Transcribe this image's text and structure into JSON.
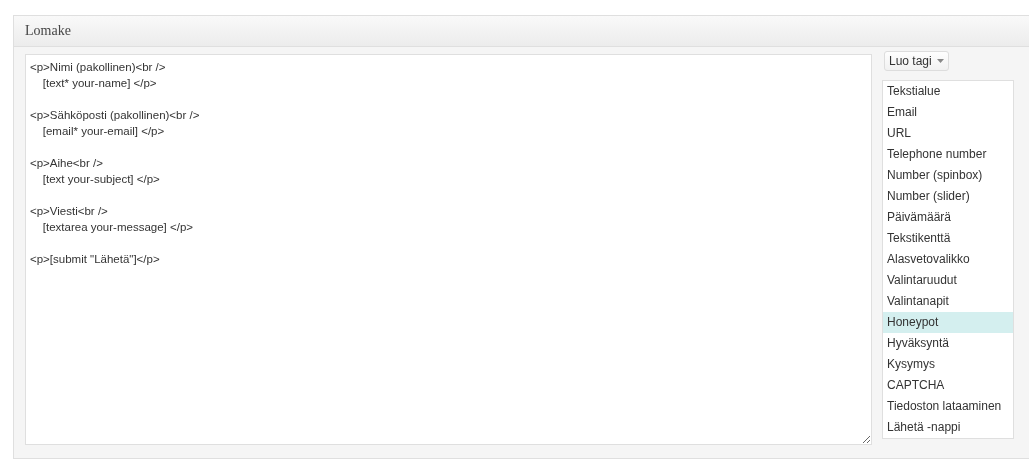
{
  "panel": {
    "title": "Lomake"
  },
  "editor": {
    "value": "<p>Nimi (pakollinen)<br />\n    [text* your-name] </p>\n\n<p>Sähköposti (pakollinen)<br />\n    [email* your-email] </p>\n\n<p>Aihe<br />\n    [text your-subject] </p>\n\n<p>Viesti<br />\n    [textarea your-message] </p>\n\n<p>[submit \"Lähetä\"]</p>"
  },
  "tag_button": {
    "label": "Luo tagi"
  },
  "tag_list": [
    {
      "label": "Tekstialue",
      "selected": false
    },
    {
      "label": "Email",
      "selected": false
    },
    {
      "label": "URL",
      "selected": false
    },
    {
      "label": "Telephone number",
      "selected": false
    },
    {
      "label": "Number (spinbox)",
      "selected": false
    },
    {
      "label": "Number (slider)",
      "selected": false
    },
    {
      "label": "Päivämäärä",
      "selected": false
    },
    {
      "label": "Tekstikenttä",
      "selected": false
    },
    {
      "label": "Alasvetovalikko",
      "selected": false
    },
    {
      "label": "Valintaruudut",
      "selected": false
    },
    {
      "label": "Valintanapit",
      "selected": false
    },
    {
      "label": "Honeypot",
      "selected": true
    },
    {
      "label": "Hyväksyntä",
      "selected": false
    },
    {
      "label": "Kysymys",
      "selected": false
    },
    {
      "label": "CAPTCHA",
      "selected": false
    },
    {
      "label": "Tiedoston lataaminen",
      "selected": false
    },
    {
      "label": "Lähetä -nappi",
      "selected": false
    }
  ]
}
